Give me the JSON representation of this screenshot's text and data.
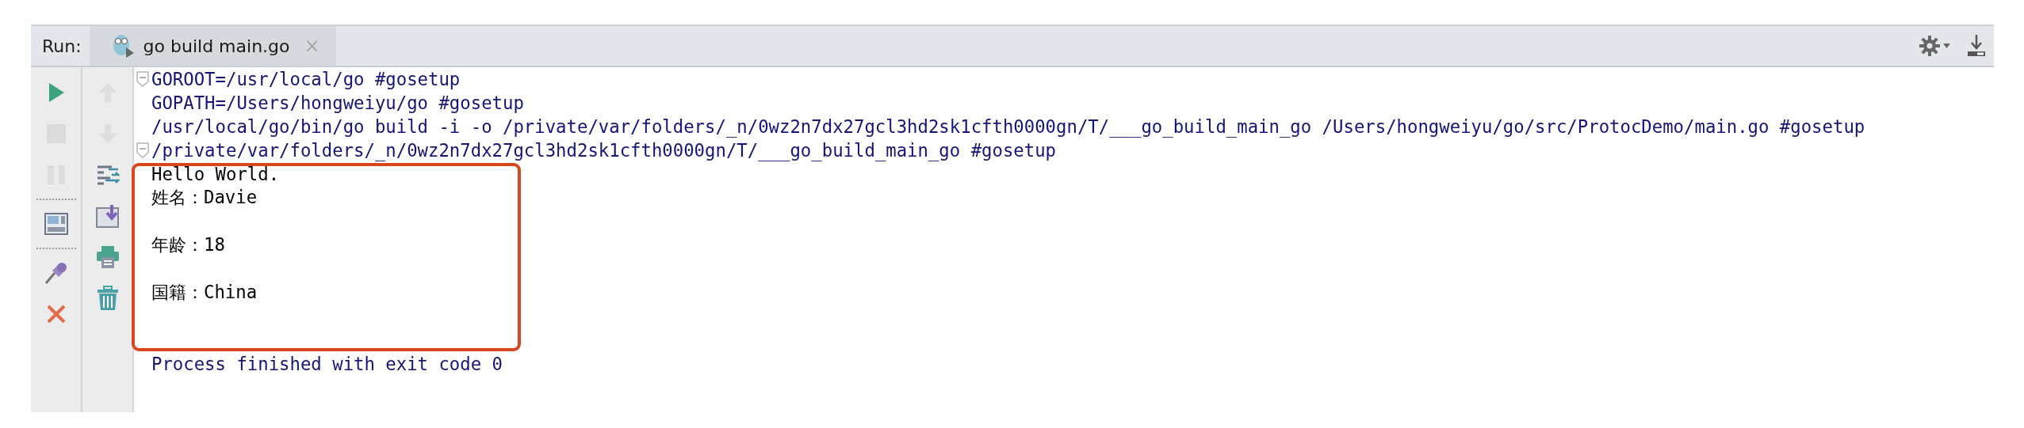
{
  "run_panel": {
    "label": "Run:",
    "tabs": [
      {
        "label": "go build main.go",
        "selected": true,
        "close_glyph": "×"
      }
    ],
    "header_actions": [
      {
        "kind": "settings"
      },
      {
        "kind": "download"
      }
    ],
    "toolbar_primary": [
      {
        "kind": "run",
        "disabled": false
      },
      {
        "kind": "stop",
        "disabled": true
      },
      {
        "kind": "pause",
        "disabled": true
      },
      {
        "kind": "separator"
      },
      {
        "kind": "layout",
        "disabled": false
      },
      {
        "kind": "separator"
      },
      {
        "kind": "pin",
        "disabled": false
      },
      {
        "kind": "close",
        "disabled": false
      }
    ],
    "toolbar_secondary": [
      {
        "kind": "up",
        "disabled": true
      },
      {
        "kind": "down",
        "disabled": true
      },
      {
        "kind": "wrap",
        "disabled": false
      },
      {
        "kind": "scroll_end",
        "disabled": false
      },
      {
        "kind": "print",
        "disabled": false
      },
      {
        "kind": "trash",
        "disabled": false
      }
    ],
    "console": [
      {
        "kind": "system",
        "fold_marker": true,
        "text": "GOROOT=/usr/local/go #gosetup"
      },
      {
        "kind": "system",
        "fold_marker": false,
        "text": "GOPATH=/Users/hongweiyu/go #gosetup"
      },
      {
        "kind": "system",
        "fold_marker": false,
        "text": "/usr/local/go/bin/go build -i -o /private/var/folders/_n/0wz2n7dx27gcl3hd2sk1cfth0000gn/T/___go_build_main_go /Users/hongweiyu/go/src/ProtocDemo/main.go #gosetup"
      },
      {
        "kind": "system",
        "fold_marker": true,
        "text": "/private/var/folders/_n/0wz2n7dx27gcl3hd2sk1cfth0000gn/T/___go_build_main_go #gosetup"
      },
      {
        "kind": "output",
        "fold_marker": false,
        "text": "Hello World."
      },
      {
        "kind": "output",
        "fold_marker": false,
        "text": "姓名：Davie"
      },
      {
        "kind": "blank"
      },
      {
        "kind": "output",
        "fold_marker": false,
        "text": "年龄：18"
      },
      {
        "kind": "blank"
      },
      {
        "kind": "output",
        "fold_marker": false,
        "text": "国籍：China"
      },
      {
        "kind": "blank"
      },
      {
        "kind": "blank"
      },
      {
        "kind": "system",
        "fold_marker": false,
        "text": "Process finished with exit code 0"
      }
    ]
  }
}
